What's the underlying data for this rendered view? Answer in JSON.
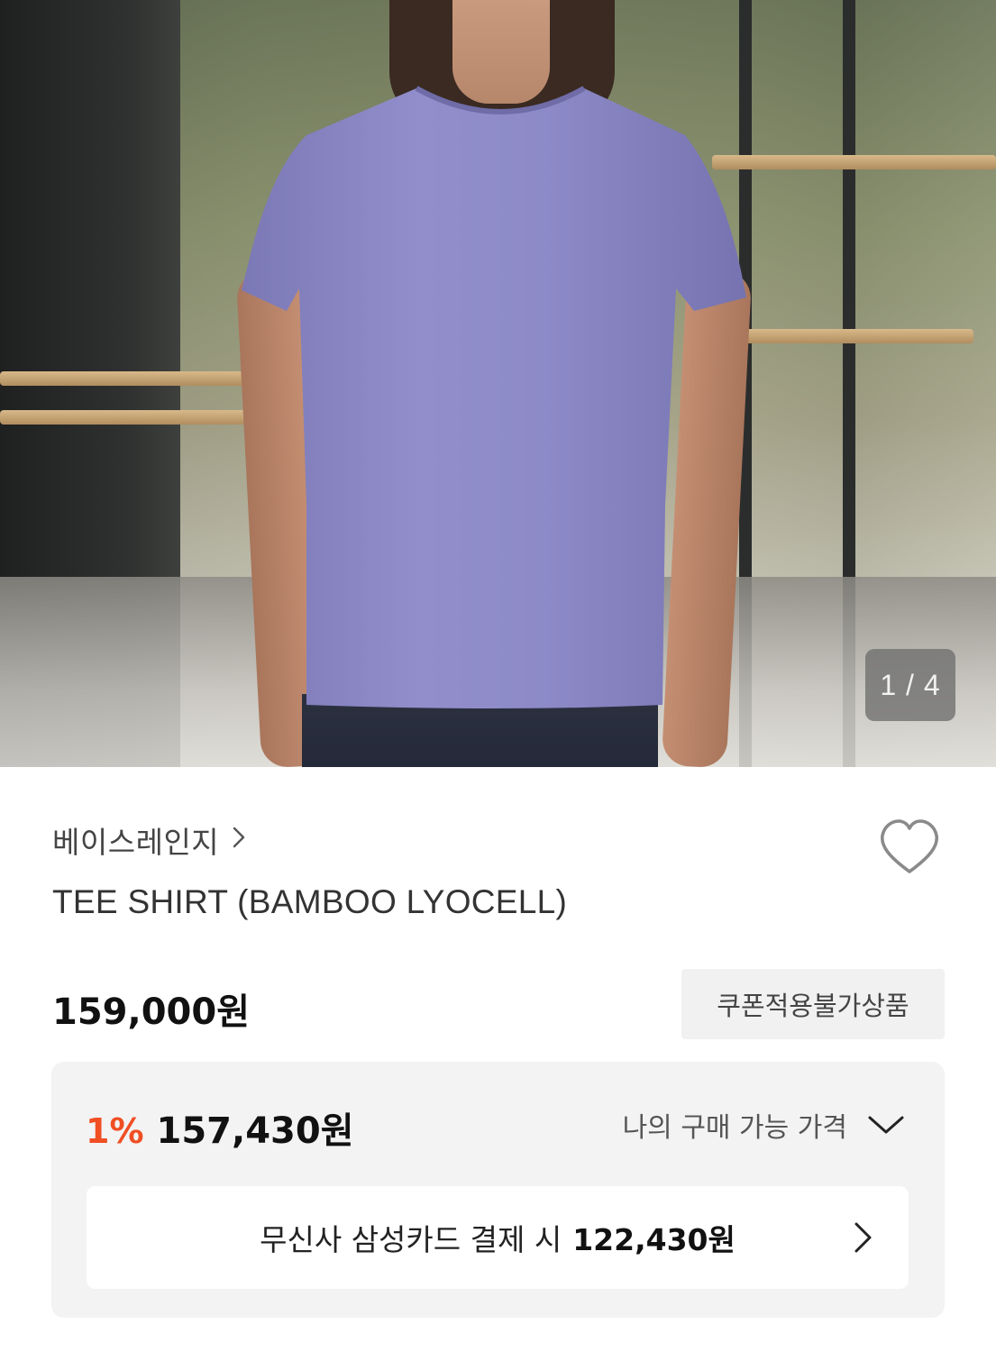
{
  "gallery": {
    "current": "1",
    "total": "4",
    "counter_text": "1 / 4"
  },
  "product": {
    "brand": "베이스레인지",
    "name": "TEE SHIRT (BAMBOO LYOCELL)",
    "price": "159,000원",
    "coupon_notice": "쿠폰적용불가상품"
  },
  "benefit": {
    "discount_rate": "1%",
    "discount_price": "157,430원",
    "my_price_label": "나의 구매 가능 가격",
    "card_offer_text": "무신사 삼성카드 결제 시",
    "card_offer_price": "122,430원"
  },
  "colors": {
    "discount_accent": "#f04e23",
    "shirt": "#8a87c4",
    "background": "#ffffff",
    "panel": "#f3f3f3"
  },
  "icons": {
    "brand_chevron": "chevron-right-icon",
    "like": "heart-outline-icon",
    "expand": "chevron-down-icon",
    "card_chevron": "chevron-right-icon"
  }
}
